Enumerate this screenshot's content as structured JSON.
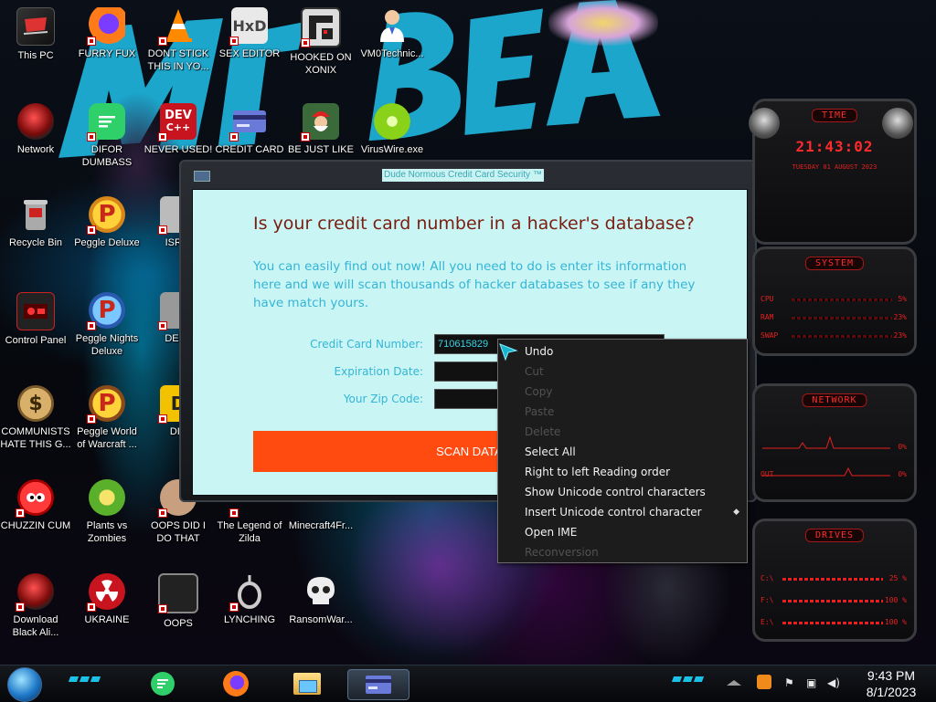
{
  "desktop": {
    "icons": [
      {
        "label": "This PC"
      },
      {
        "label": "FURRY FUX"
      },
      {
        "label": "DONT STICK THIS IN YO..."
      },
      {
        "label": "SEX EDITOR"
      },
      {
        "label": "HOOKED ON XONIX"
      },
      {
        "label": "VM0Technic..."
      },
      {
        "label": "Network"
      },
      {
        "label": "DIFOR DUMBASS"
      },
      {
        "label": "NEVER USED!"
      },
      {
        "label": "CREDIT CARD"
      },
      {
        "label": "BE JUST LIKE"
      },
      {
        "label": "VirusWire.exe"
      },
      {
        "label": "Recycle Bin"
      },
      {
        "label": "Peggle Deluxe"
      },
      {
        "label": "ISRAI"
      },
      {
        "label": "Control Panel"
      },
      {
        "label": "Peggle Nights Deluxe"
      },
      {
        "label": "DEEZ"
      },
      {
        "label": "COMMUNISTS HATE THIS G..."
      },
      {
        "label": "Peggle World of Warcraft ..."
      },
      {
        "label": "DIE"
      },
      {
        "label": "CHUZZIN CUM"
      },
      {
        "label": "Plants vs Zombies"
      },
      {
        "label": "OOPS DID I DO THAT"
      },
      {
        "label": "The Legend of Zilda"
      },
      {
        "label": "Minecraft4Fr..."
      },
      {
        "label": "Download Black Ali..."
      },
      {
        "label": "UKRAINE"
      },
      {
        "label": "OOPS"
      },
      {
        "label": "LYNCHING"
      },
      {
        "label": "RansomWar..."
      }
    ]
  },
  "dialog": {
    "title": "Dude Normous Credit Card Security ™",
    "heading": "Is your credit card number in a hacker's database?",
    "body": "You can easily find out now! All you need to do is enter its information here and we will scan thousands of hacker databases to see if any they have match yours.",
    "fields": {
      "card_label": "Credit Card Number:",
      "card_value": "710615829",
      "exp_label": "Expiration Date:",
      "exp_value": "",
      "zip_label": "Your Zip Code:",
      "zip_value": ""
    },
    "scan_button": "SCAN DATABASES"
  },
  "context_menu": {
    "items": [
      {
        "label": "Undo",
        "enabled": true
      },
      {
        "label": "Cut",
        "enabled": false
      },
      {
        "label": "Copy",
        "enabled": false
      },
      {
        "label": "Paste",
        "enabled": false
      },
      {
        "label": "Delete",
        "enabled": false
      },
      {
        "label": "Select All",
        "enabled": true
      },
      {
        "label": "Right to left Reading order",
        "enabled": true
      },
      {
        "label": "Show Unicode control characters",
        "enabled": true
      },
      {
        "label": "Insert Unicode control character",
        "enabled": true,
        "submenu": true
      },
      {
        "label": "Open IME",
        "enabled": true
      },
      {
        "label": "Reconversion",
        "enabled": false
      }
    ]
  },
  "gadget": {
    "time_title": "TIME",
    "time": "21:43:02",
    "date": "TUESDAY 01 AUGUST 2023",
    "system_title": "SYSTEM",
    "cpu_label": "CPU",
    "cpu_value": "5%",
    "ram_label": "RAM",
    "ram_value": "23%",
    "swap_label": "SWAP",
    "swap_value": "23%",
    "network_title": "NETWORK",
    "net_in_value": "0%",
    "net_out_label": "OUT",
    "net_out_value": "0%",
    "drives_title": "DRIVES",
    "drives": [
      {
        "label": "C:\\",
        "value": "25 %"
      },
      {
        "label": "F:\\",
        "value": "100 %"
      },
      {
        "label": "E:\\",
        "value": "100 %"
      }
    ]
  },
  "taskbar": {
    "time": "9:43 PM",
    "date": "8/1/2023"
  },
  "colors": {
    "dialog_bg": "#c9f6f5",
    "heading": "#7a1d10",
    "body_text": "#35b4d6",
    "scan_button": "#ff4a10",
    "gadget_red": "#e62020"
  }
}
